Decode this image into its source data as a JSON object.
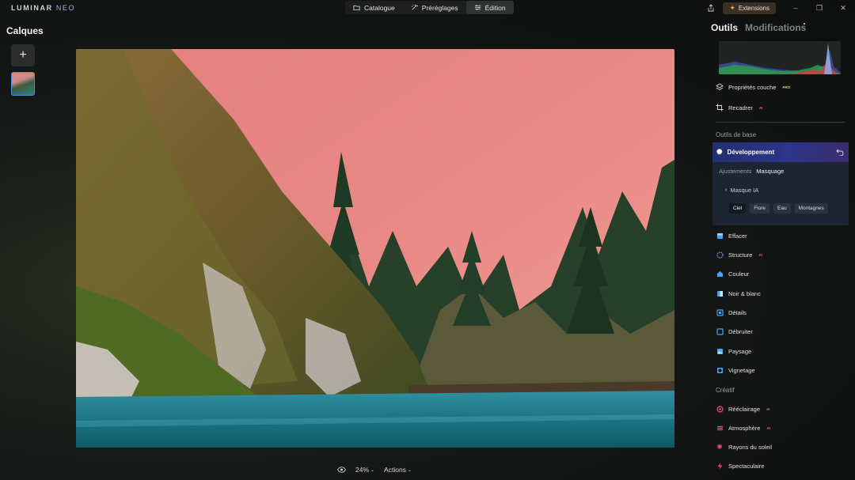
{
  "app": {
    "logo_main": "LUMINAR",
    "logo_sub": "NEO"
  },
  "nav": {
    "tabs": [
      {
        "label": "Catalogue",
        "icon": "folder-icon"
      },
      {
        "label": "Préréglages",
        "icon": "presets-icon"
      },
      {
        "label": "Édition",
        "icon": "sliders-icon"
      }
    ],
    "active": "Édition"
  },
  "topright": {
    "extensions_label": "Extensions"
  },
  "layers": {
    "title": "Calques",
    "add_label": "+"
  },
  "bottom": {
    "zoom": "24%",
    "actions_label": "Actions"
  },
  "rpanel": {
    "tabs": [
      "Outils",
      "Modifications"
    ],
    "items_top": [
      {
        "label": "Propriétés couche",
        "badge": "PRO",
        "icon": "layers-stack-icon"
      },
      {
        "label": "Recadrer",
        "badge": "AI",
        "icon": "crop-icon"
      }
    ],
    "section_base": "Outils de base",
    "development": {
      "label": "Développement",
      "subtabs": [
        "Ajustements",
        "Masquage"
      ],
      "mask_label": "Masque IA",
      "chips": [
        "Ciel",
        "Flore",
        "Eau",
        "Montagnes"
      ]
    },
    "tools_base": [
      {
        "label": "Effacer",
        "badge": "",
        "icon": "eraser-icon",
        "color": "#4aa3f0"
      },
      {
        "label": "Structure",
        "badge": "AI",
        "icon": "structure-icon",
        "color": "#4aa3f0"
      },
      {
        "label": "Couleur",
        "badge": "",
        "icon": "color-icon",
        "color": "#4aa3f0"
      },
      {
        "label": "Noir & blanc",
        "badge": "",
        "icon": "bw-icon",
        "color": "#4aa3f0"
      },
      {
        "label": "Détails",
        "badge": "",
        "icon": "details-icon",
        "color": "#4aa3f0"
      },
      {
        "label": "Débruiter",
        "badge": "",
        "icon": "denoise-icon",
        "color": "#4aa3f0"
      },
      {
        "label": "Paysage",
        "badge": "",
        "icon": "landscape-icon",
        "color": "#4aa3f0"
      },
      {
        "label": "Vignetage",
        "badge": "",
        "icon": "vignette-icon",
        "color": "#4aa3f0"
      }
    ],
    "section_creative": "Créatif",
    "tools_creative": [
      {
        "label": "Rééclairage",
        "badge": "AI",
        "icon": "relight-icon",
        "color": "#e84a8a"
      },
      {
        "label": "Atmosphère",
        "badge": "AI",
        "icon": "atmosphere-icon",
        "color": "#e84a8a"
      },
      {
        "label": "Rayons du soleil",
        "badge": "",
        "icon": "sunrays-icon",
        "color": "#e84a8a"
      },
      {
        "label": "Spectaculaire",
        "badge": "",
        "icon": "dramatic-icon",
        "color": "#e84a8a"
      }
    ]
  }
}
